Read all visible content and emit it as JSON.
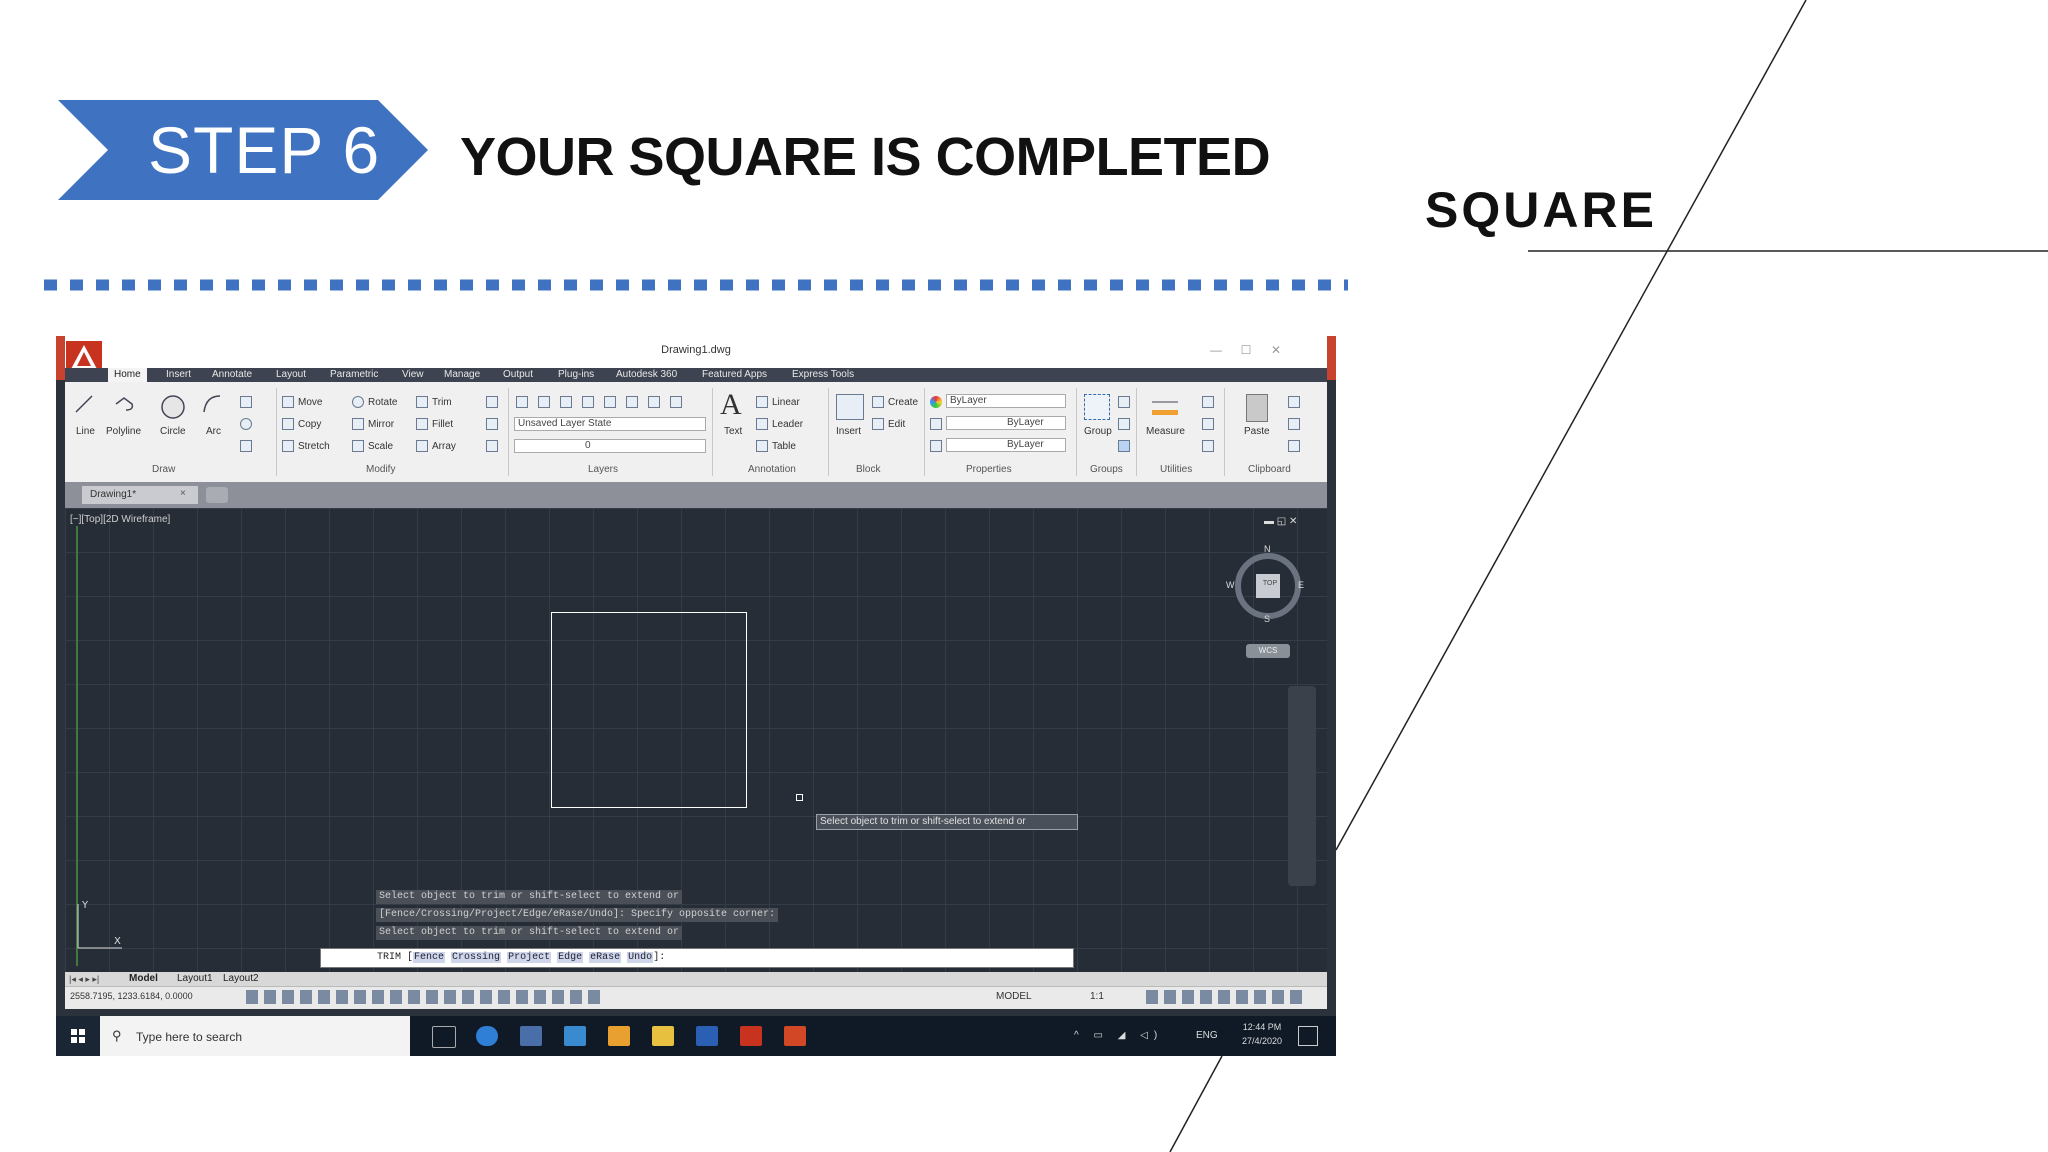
{
  "slide": {
    "step_label": "STEP 6",
    "title": "YOUR SQUARE IS COMPLETED",
    "side_title": "SQUARE",
    "accent_color": "#3f72c0"
  },
  "app": {
    "doc_title": "Drawing1.dwg",
    "window_controls": [
      "—",
      "☐",
      "✕"
    ],
    "tabs": [
      "Home",
      "Insert",
      "Annotate",
      "Layout",
      "Parametric",
      "View",
      "Manage",
      "Output",
      "Plug-ins",
      "Autodesk 360",
      "Featured Apps",
      "Express Tools"
    ],
    "active_tab": "Home",
    "draw_tools": [
      "Line",
      "Polyline",
      "Circle",
      "Arc"
    ],
    "modify_tools": [
      "Move",
      "Rotate",
      "Trim",
      "Copy",
      "Mirror",
      "Fillet",
      "Stretch",
      "Scale",
      "Array"
    ],
    "layer_state": "Unsaved Layer State",
    "layer_current": "0",
    "annotation_tools": [
      "Text",
      "Linear",
      "Leader",
      "Table"
    ],
    "block_tools": [
      "Insert",
      "Create",
      "Edit"
    ],
    "property_values": [
      "ByLayer",
      "ByLayer",
      "ByLayer"
    ],
    "group_label": "Group",
    "measure_label": "Measure",
    "paste_label": "Paste",
    "panels": [
      "Draw",
      "Modify",
      "Layers",
      "Annotation",
      "Block",
      "Properties",
      "Groups",
      "Utilities",
      "Clipboard"
    ],
    "file_tab": "Drawing1*",
    "viewport_label": "[−][Top][2D Wireframe]",
    "compass": {
      "n": "N",
      "s": "S",
      "e": "E",
      "w": "W",
      "top": "TOP",
      "wcs": "WCS"
    },
    "tooltip": "Select object to trim or shift-select to extend or",
    "command_history": [
      "Select object to trim or shift-select to extend or",
      "[Fence/Crossing/Project/Edge/eRase/Undo]: Specify opposite corner:",
      "Select object to trim or shift-select to extend or"
    ],
    "command_line": {
      "prefix": "TRIM [",
      "options": [
        "Fence",
        "Crossing",
        "Project",
        "Edge",
        "eRase",
        "Undo"
      ],
      "suffix": "]:"
    },
    "layout_tabs": [
      "Model",
      "Layout1",
      "Layout2"
    ],
    "coordinates": "2558.7195, 1233.6184, 0.0000",
    "model_label": "MODEL",
    "scale": "1:1"
  },
  "taskbar": {
    "search_placeholder": "Type here to search",
    "language": "ENG",
    "time": "12:44 PM",
    "date": "27/4/2020"
  }
}
